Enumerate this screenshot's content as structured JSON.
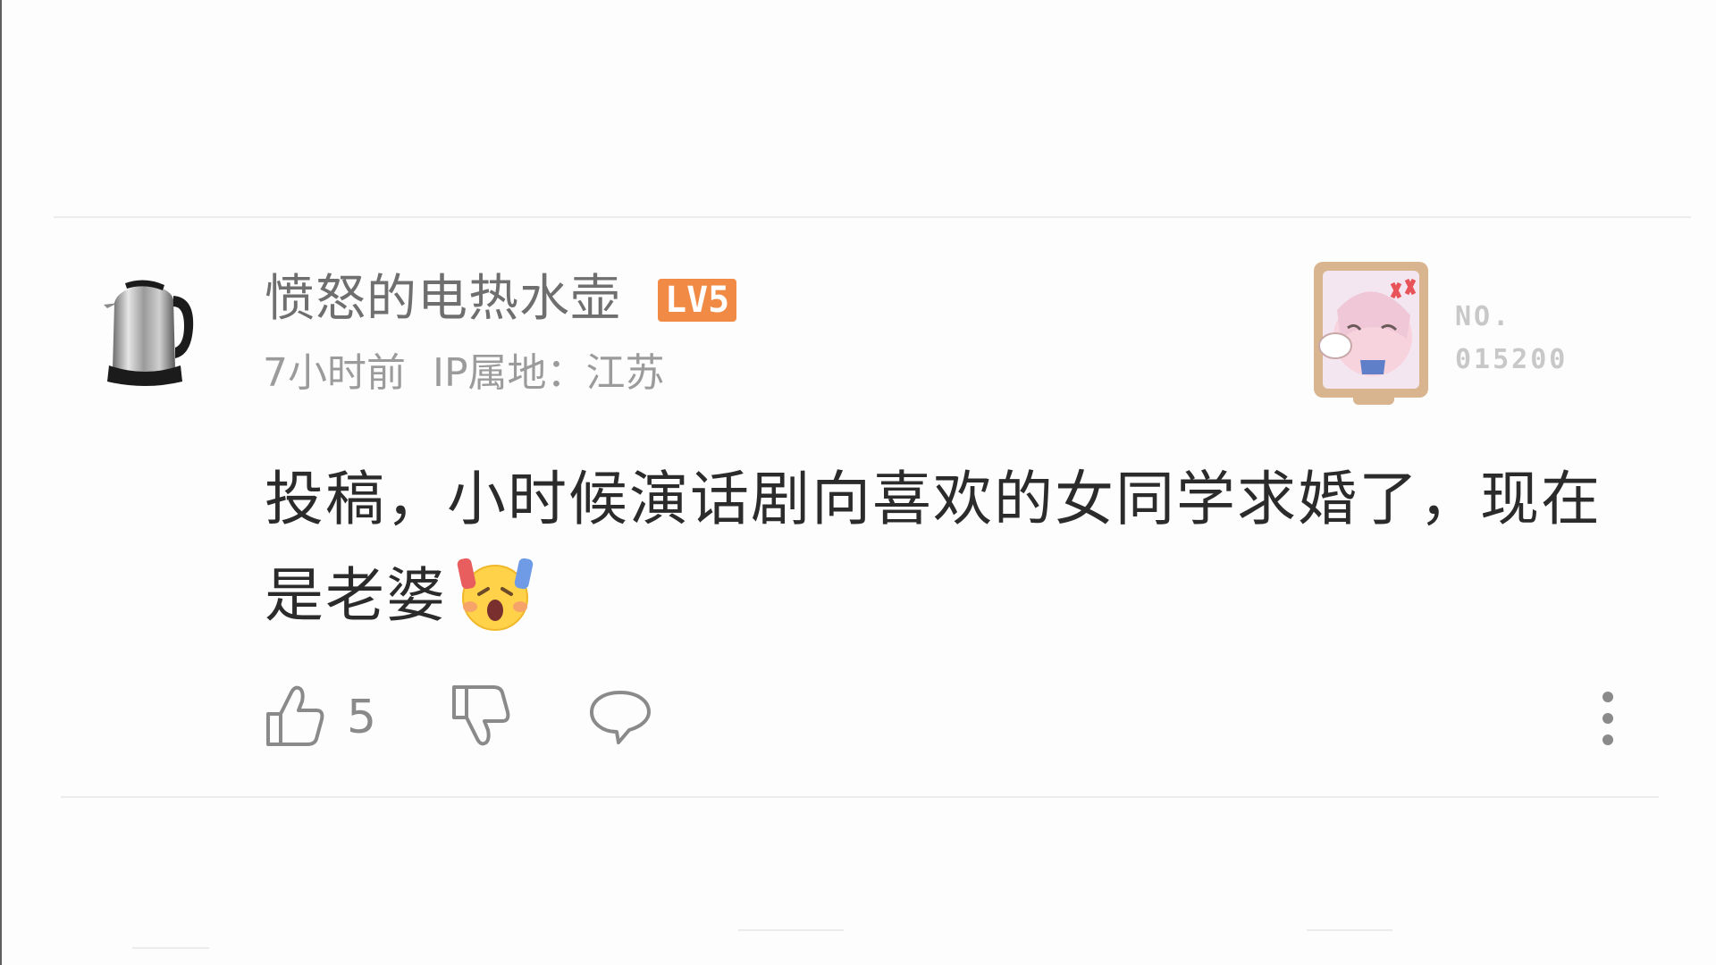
{
  "comment": {
    "username": "愤怒的电热水壶",
    "level_badge": "LV5",
    "time": "7小时前",
    "ip_location": "IP属地：江苏",
    "fan_badge": {
      "label": "NO.",
      "number": "015200"
    },
    "content": "投稿，小时候演话剧向喜欢的女同学求婚了，现在是老婆",
    "like_count": "5"
  },
  "icons": {
    "avatar": "electric-kettle",
    "emoji": "crying-excited-face",
    "like": "thumbs-up-outline",
    "dislike": "thumbs-down-outline",
    "reply": "speech-bubble-outline",
    "more": "vertical-ellipsis"
  },
  "colors": {
    "background": "#fdfdfd",
    "username": "#6f6f6f",
    "level_badge": "#f08a45",
    "meta": "#9b9b9b",
    "content": "#2b2b2b",
    "icon": "#8a8a8a"
  }
}
